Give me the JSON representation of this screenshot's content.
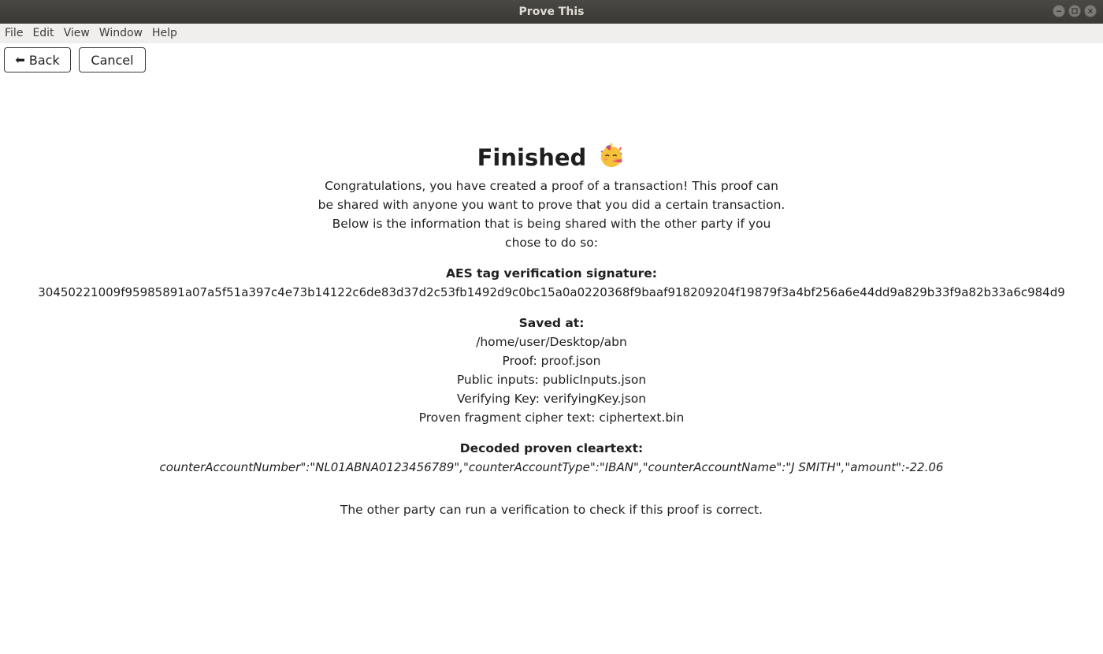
{
  "window": {
    "title": "Prove This"
  },
  "menu": [
    {
      "label": "File"
    },
    {
      "label": "Edit"
    },
    {
      "label": "View"
    },
    {
      "label": "Window"
    },
    {
      "label": "Help"
    }
  ],
  "toolbar": {
    "back_label": "Back",
    "back_arrow": "⬅",
    "cancel_label": "Cancel"
  },
  "main": {
    "title": "Finished",
    "title_emoji": "party-face-icon",
    "intro": "Congratulations, you have created a proof of a transaction! This proof can be shared with anyone you want to prove that you did a certain transaction. Below is the information that is being shared with the other party if you chose to do so:",
    "signature": {
      "label": "AES tag verification signature:",
      "value": "30450221009f95985891a07a5f51a397c4e73b14122c6de83d37d2c53fb1492d9c0bc15a0a0220368f9baaf918209204f19879f3a4bf256a6e44dd9a829b33f9a82b33a6c984d9"
    },
    "saved": {
      "label": "Saved at:",
      "path": "/home/user/Desktop/abn",
      "proof": "Proof: proof.json",
      "public_inputs": "Public inputs: publicInputs.json",
      "verifying_key": "Verifying Key: verifyingKey.json",
      "ciphertext": "Proven fragment cipher text: ciphertext.bin"
    },
    "decoded": {
      "label": "Decoded proven cleartext:",
      "value": "counterAccountNumber\":\"NL01ABNA0123456789\",\"counterAccountType\":\"IBAN\",\"counterAccountName\":\"J SMITH\",\"amount\":-22.06"
    },
    "footer": "The other party can run a verification to check if this proof is correct."
  },
  "colors": {
    "titlebar": "#3d3c39",
    "menubar": "#f0efed",
    "background": "#ffffff",
    "text": "#1f1f1f"
  }
}
